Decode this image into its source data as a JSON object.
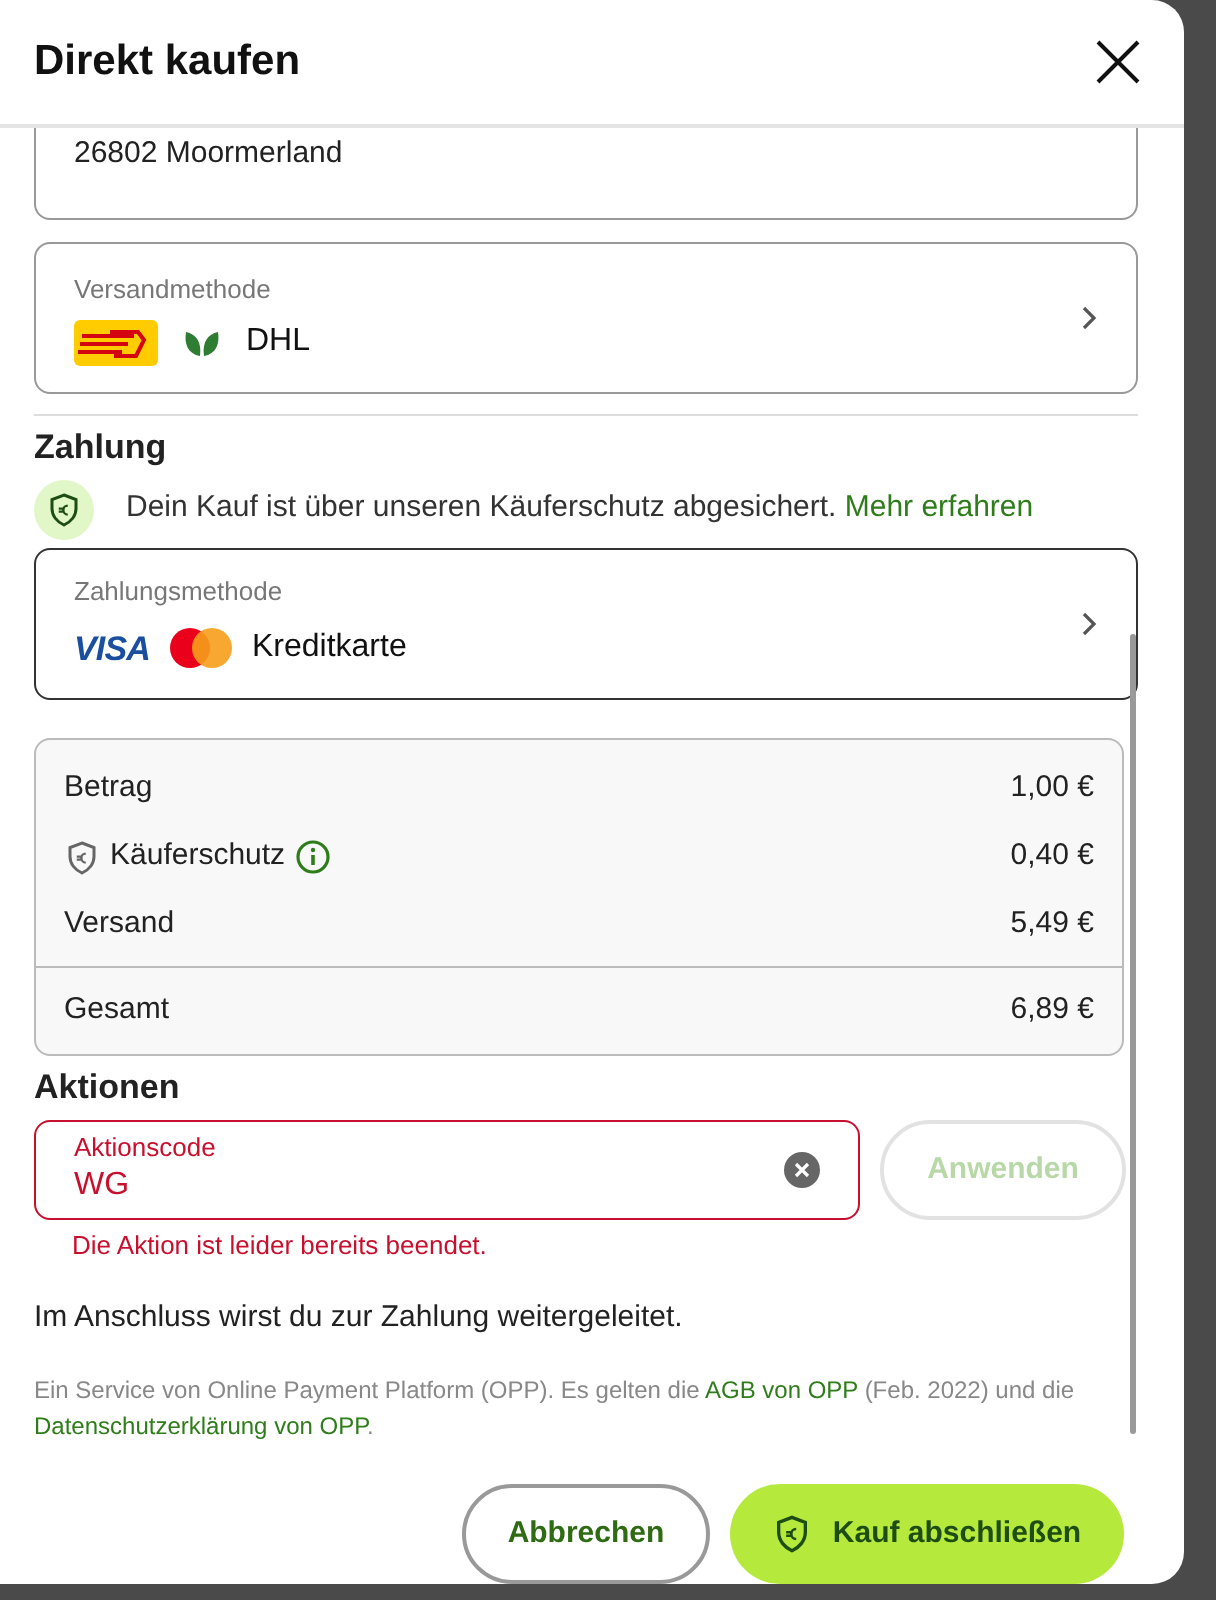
{
  "dialog": {
    "title": "Direkt kaufen"
  },
  "address": {
    "line": "26802 Moormerland"
  },
  "shipping": {
    "label": "Versandmethode",
    "value": "DHL"
  },
  "payment_section": {
    "heading": "Zahlung",
    "protection_text": "Dein Kauf ist über unseren Käuferschutz abgesichert.",
    "protection_link": "Mehr erfahren",
    "method_label": "Zahlungsmethode",
    "method_value": "Kreditkarte",
    "visa": "VISA"
  },
  "summary": {
    "rows": [
      {
        "label": "Betrag",
        "value": "1,00 €",
        "kind": "plain"
      },
      {
        "label": "Käuferschutz",
        "value": "0,40 €",
        "kind": "protection"
      },
      {
        "label": "Versand",
        "value": "5,49 €",
        "kind": "plain"
      }
    ],
    "total": {
      "label": "Gesamt",
      "value": "6,89 €"
    }
  },
  "promotions": {
    "heading": "Aktionen",
    "field_label": "Aktionscode",
    "field_value": "WG",
    "error": "Die Aktion ist leider bereits beendet.",
    "apply_button": "Anwenden",
    "apply_disabled": true
  },
  "redirect_note": "Im Anschluss wirst du zur Zahlung weitergeleitet.",
  "legal": {
    "text_1": "Ein Service von Online Payment Platform (OPP). Es gelten die",
    "link_1": "AGB von OPP",
    "text_2": "(Feb. 2022) und die",
    "link_2": "Datenschutzerklärung von OPP",
    "text_3": "."
  },
  "buttons": {
    "cancel": "Abbrechen",
    "confirm": "Kauf abschließen"
  }
}
